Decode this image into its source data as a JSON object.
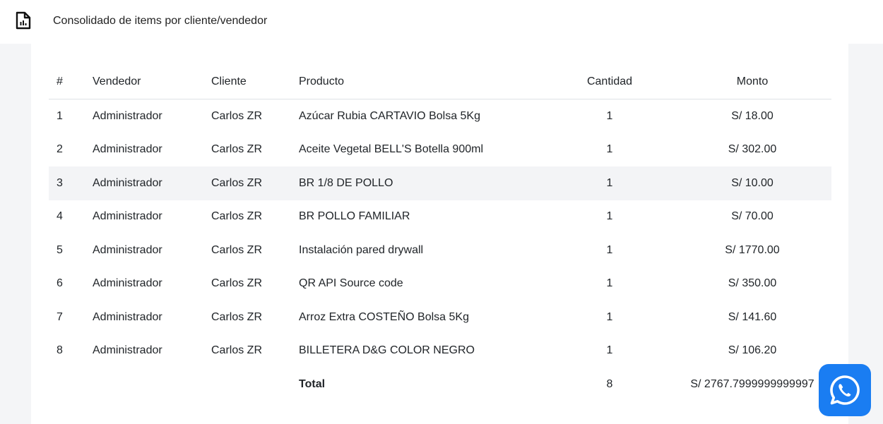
{
  "header": {
    "title": "Consolidado de items por cliente/vendedor"
  },
  "table": {
    "columns": [
      "#",
      "Vendedor",
      "Cliente",
      "Producto",
      "Cantidad",
      "Monto"
    ],
    "rows": [
      {
        "num": "1",
        "vendedor": "Administrador",
        "cliente": "Carlos ZR",
        "producto": "Azúcar Rubia CARTAVIO Bolsa 5Kg",
        "cantidad": "1",
        "monto": "S/ 18.00"
      },
      {
        "num": "2",
        "vendedor": "Administrador",
        "cliente": "Carlos ZR",
        "producto": "Aceite Vegetal BELL'S Botella 900ml",
        "cantidad": "1",
        "monto": "S/ 302.00"
      },
      {
        "num": "3",
        "vendedor": "Administrador",
        "cliente": "Carlos ZR",
        "producto": "BR 1/8 DE POLLO",
        "cantidad": "1",
        "monto": "S/ 10.00"
      },
      {
        "num": "4",
        "vendedor": "Administrador",
        "cliente": "Carlos ZR",
        "producto": "BR POLLO FAMILIAR",
        "cantidad": "1",
        "monto": "S/ 70.00"
      },
      {
        "num": "5",
        "vendedor": "Administrador",
        "cliente": "Carlos ZR",
        "producto": "Instalación pared drywall",
        "cantidad": "1",
        "monto": "S/ 1770.00"
      },
      {
        "num": "6",
        "vendedor": "Administrador",
        "cliente": "Carlos ZR",
        "producto": "QR API Source code",
        "cantidad": "1",
        "monto": "S/ 350.00"
      },
      {
        "num": "7",
        "vendedor": "Administrador",
        "cliente": "Carlos ZR",
        "producto": "Arroz Extra COSTEÑO Bolsa 5Kg",
        "cantidad": "1",
        "monto": "S/ 141.60"
      },
      {
        "num": "8",
        "vendedor": "Administrador",
        "cliente": "Carlos ZR",
        "producto": "BILLETERA D&G COLOR NEGRO",
        "cantidad": "1",
        "monto": "S/ 106.20"
      }
    ],
    "total": {
      "label": "Total",
      "cantidad": "8",
      "monto": "S/ 2767.7999999999997"
    }
  },
  "icons": {
    "header_icon": "report-icon",
    "floating_button_icon": "whatsapp-icon"
  },
  "colors": {
    "accent": "#1a7df2",
    "highlight_row": "#f3f4f6",
    "background": "#f4f5f7"
  }
}
